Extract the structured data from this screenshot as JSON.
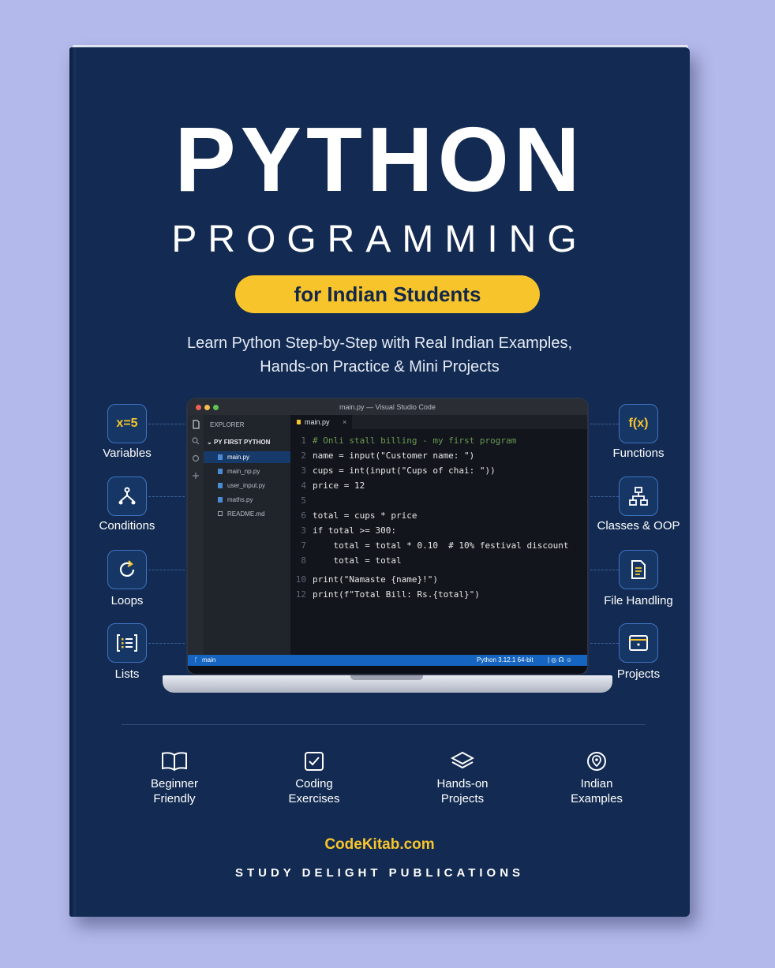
{
  "cover": {
    "title": "PYTHON",
    "subtitle": "PROGRAMMING",
    "badge": "for Indian Students",
    "tagline_lines": [
      "Learn Python Step-by-Step with Real Indian Examples,",
      "Hands-on Practice & Mini Projects"
    ],
    "website": "CodeKitab.com",
    "publisher": "STUDY DELIGHT PUBLICATIONS"
  },
  "left_topics": [
    {
      "label": "Variables",
      "icon_text": "x=5",
      "icon": "variable-icon"
    },
    {
      "label": "Conditions",
      "icon": "branch-icon"
    },
    {
      "label": "Loops",
      "icon": "loop-icon"
    },
    {
      "label": "Lists",
      "icon": "list-icon"
    }
  ],
  "right_topics": [
    {
      "label": "Functions",
      "icon_text": "f(x)",
      "icon": "function-icon"
    },
    {
      "label": "Classes & OOP",
      "icon": "hierarchy-icon"
    },
    {
      "label": "File Handling",
      "icon": "document-icon"
    },
    {
      "label": "Projects",
      "icon": "project-window-icon"
    }
  ],
  "editor": {
    "window_title": "main.py — Visual Studio Code",
    "explorer_header": "EXPLORER",
    "folder": "PY FIRST PYTHON",
    "files": [
      "main.py",
      "main_np.py",
      "user_input.py",
      "maths.py",
      "README.md"
    ],
    "active_tab": "main.py",
    "tab_close": "×",
    "lines": [
      {
        "n": "1",
        "text": "# Onli stall billing - my first program"
      },
      {
        "n": "2",
        "text": "name = input(\"Customer name: \")"
      },
      {
        "n": "3",
        "text": "cups = int(input(\"Cups of chai: \"))"
      },
      {
        "n": "4",
        "text": "price = 12"
      },
      {
        "n": "5",
        "text": ""
      },
      {
        "n": "6",
        "text": "total = cups * price"
      },
      {
        "n": "3",
        "text": "if total >= 300:"
      },
      {
        "n": "7",
        "text": "    total = total * 0.10  # 10% festival discount"
      },
      {
        "n": "8",
        "text": "    total = total"
      },
      {
        "n": "10",
        "text": "print(\"Namaste {name}!\")"
      },
      {
        "n": "12",
        "text": "print(f\"Total Bill: Rs.{total}\")"
      }
    ],
    "status_branch": "main",
    "status_right": "Python 3.12.1 64-bit"
  },
  "features": [
    {
      "line1": "Beginner",
      "line2": "Friendly",
      "icon": "open-book-icon"
    },
    {
      "line1": "Coding",
      "line2": "Exercises",
      "icon": "checkbox-icon"
    },
    {
      "line1": "Hands-on",
      "line2": "Projects",
      "icon": "layers-icon"
    },
    {
      "line1": "Indian",
      "line2": "Examples",
      "icon": "location-pin-icon"
    }
  ],
  "colors": {
    "cover": "#132b52",
    "accent": "#f7c52b",
    "background": "#b3b9ea"
  }
}
